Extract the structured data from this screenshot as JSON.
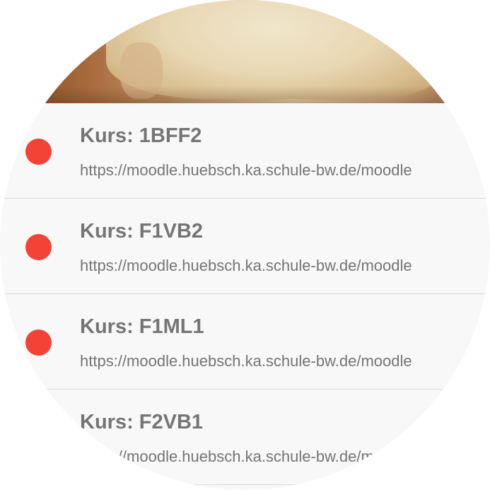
{
  "header": {
    "image": "bread-photo"
  },
  "courses": [
    {
      "title": "Kurs: 1BFF2",
      "url": "https://moodle.huebsch.ka.schule-bw.de/moodle",
      "status_color": "#f44336"
    },
    {
      "title": "Kurs: F1VB2",
      "url": "https://moodle.huebsch.ka.schule-bw.de/moodle",
      "status_color": "#f44336"
    },
    {
      "title": "Kurs: F1ML1",
      "url": "https://moodle.huebsch.ka.schule-bw.de/moodle",
      "status_color": "#f44336"
    },
    {
      "title": "Kurs: F2VB1",
      "url": "https://moodle.huebsch.ka.schule-bw.de/moodle",
      "status_color": "#f44336"
    }
  ]
}
